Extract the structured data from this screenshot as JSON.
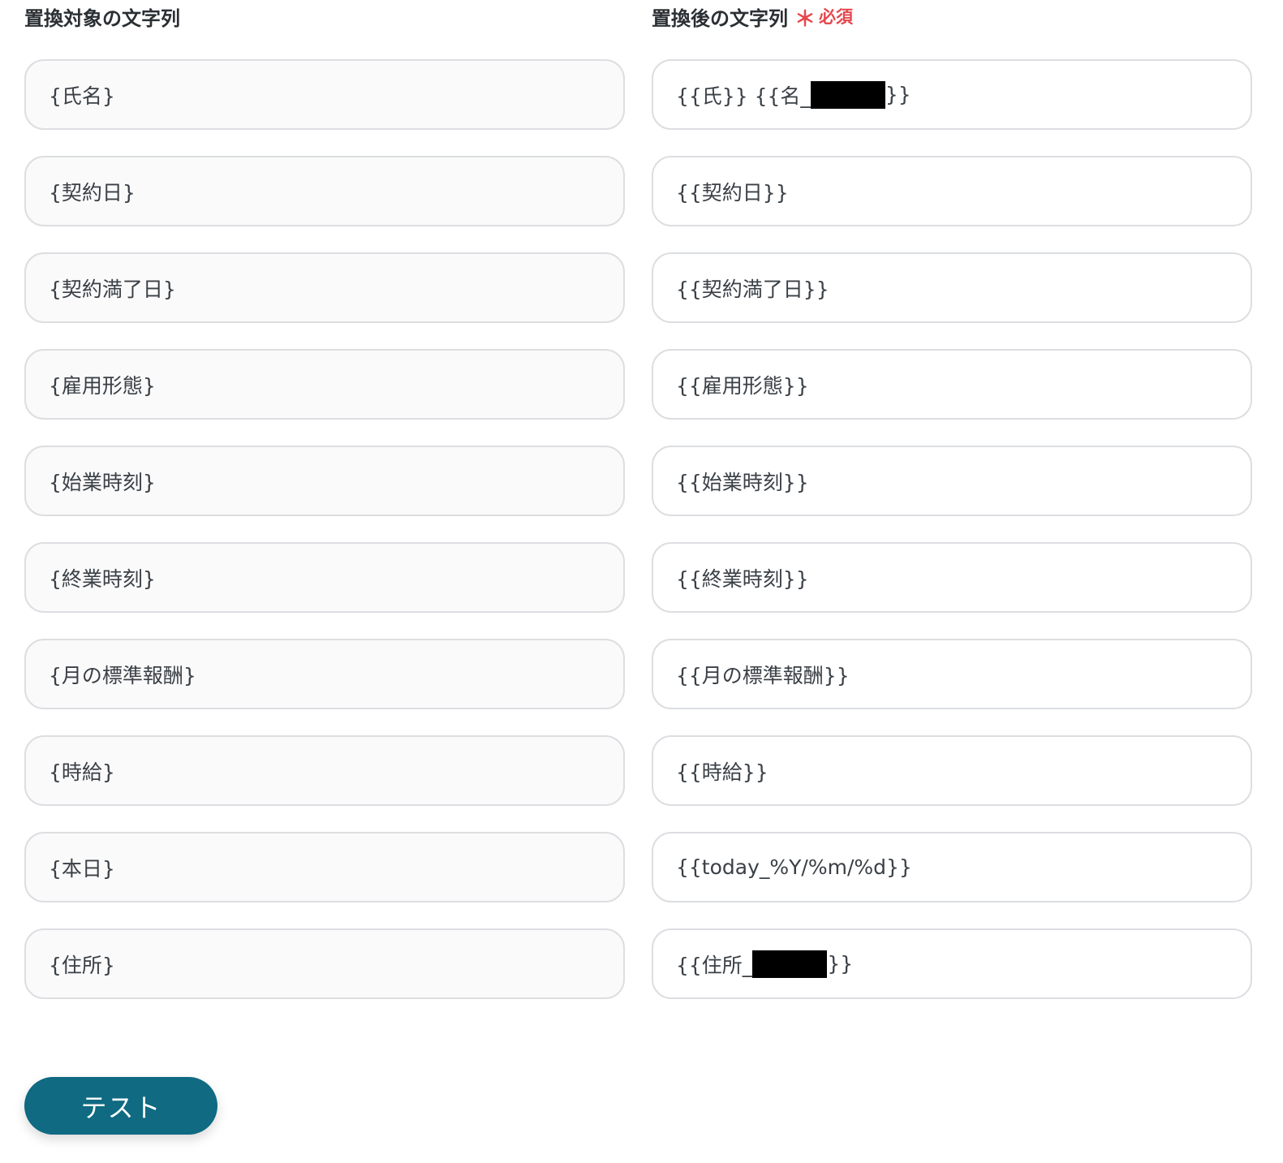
{
  "left_column": {
    "header": "置換対象の文字列",
    "fields": [
      "{氏名}",
      "{契約日}",
      "{契約満了日}",
      "{雇用形態}",
      "{始業時刻}",
      "{終業時刻}",
      "{月の標準報酬}",
      "{時給}",
      "{本日}",
      "{住所}"
    ]
  },
  "right_column": {
    "header": "置換後の文字列",
    "required_star": "＊",
    "required_label": "必須",
    "fields": [
      {
        "before": "{{氏}} {{名_",
        "after": "}}"
      },
      {
        "before": "{{契約日}}"
      },
      {
        "before": "{{契約満了日}}"
      },
      {
        "before": "{{雇用形態}}"
      },
      {
        "before": "{{始業時刻}}"
      },
      {
        "before": "{{終業時刻}}"
      },
      {
        "before": "{{月の標準報酬}}"
      },
      {
        "before": "{{時給}}"
      },
      {
        "before": "{{today_%Y/%m/%d}}"
      },
      {
        "before": "{{住所_",
        "after": "}}"
      }
    ]
  },
  "button": {
    "label": "テスト",
    "color": "#0f6a82"
  },
  "colors": {
    "required": "#e5484d",
    "field_border": "#dcdee1"
  }
}
